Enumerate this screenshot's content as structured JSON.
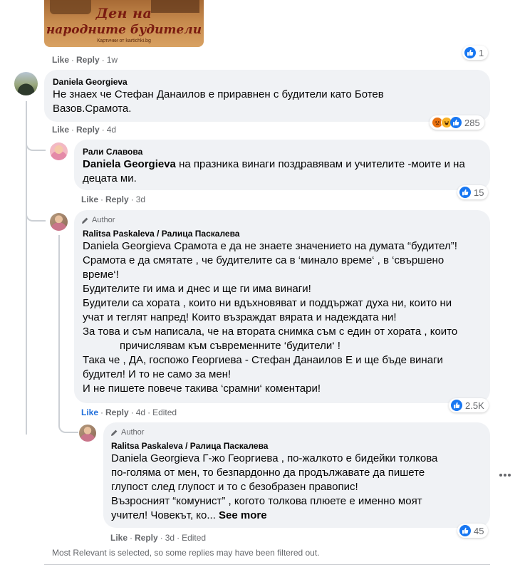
{
  "post_image": {
    "line1": "Ден на",
    "line2": "народните будители",
    "caption": "Картички от kartichki.bg"
  },
  "top_comment_actions": {
    "like": "Like",
    "reply": "Reply",
    "time": "1w",
    "reactions": "1"
  },
  "comment_daniela": {
    "author": "Daniela Georgieva",
    "text": "Не знаех че Стефан Данаилов е приравнен с будители като Ботев Вазов.Срамота.",
    "like": "Like",
    "reply": "Reply",
    "time": "4d",
    "reactions": "285",
    "reaction_icons": [
      "angry-icon",
      "haha-icon",
      "like-icon"
    ]
  },
  "reply_rali": {
    "author": "Рали Славова",
    "mention": "Daniela Georgieva",
    "text": " на празника винаги поздравявам и учителите -моите и на децата ми.",
    "like": "Like",
    "reply": "Reply",
    "time": "3d",
    "reactions": "15"
  },
  "reply_ralitsa_1": {
    "badge": "Author",
    "author": "Ralitsa Paskaleva / Ралица Паскалева",
    "mention": "Daniela Georgieva",
    "text_lines": [
      " Срамота е да не знаете значението на думата “будител”!",
      "Срамота е да смятате , че будителите са в ‘минало време‘ , в ‘свършено",
      "време‘!",
      "Будителите ги има и днес и ще ги има винаги!",
      "Будители са хората , които ни вдъхновяват и поддържат духа ни, които ни",
      "учат и теглят напред! Които възраждат вярата и надеждата ни!",
      "За това и съм написала, че на втората снимка съм с един от хората , които",
      "причислявам към съвременните ‘будители‘ !",
      "Така че , ДА, госпожо Георгиева - Стефан Данаилов Е и ще бъде винаги",
      "будител! И то не само за мен!",
      "И не пишете повече такива ‘срамни‘ коментари!"
    ],
    "like": "Like",
    "reply": "Reply",
    "time": "4d",
    "edited": "Edited",
    "reactions": "2.5K"
  },
  "reply_ralitsa_2": {
    "badge": "Author",
    "author": "Ralitsa Paskaleva / Ралица Паскалева",
    "mention": "Daniela Georgieva",
    "text_lines": [
      " Г-жо Георгиева , по-жалкото е бидейки толкова",
      "по-голяма от мен, то безпардонно да продължавате да пишете",
      "глупост след глупост и то с безобразен правопис!",
      "Възросният “комунист” , когото толкова плюете е именно моят",
      "учител! Човекът, ко..."
    ],
    "see_more": "See more",
    "like": "Like",
    "reply": "Reply",
    "time": "3d",
    "edited": "Edited",
    "reactions": "45"
  },
  "filter_note": "Most Relevant is selected, so some replies may have been filtered out."
}
